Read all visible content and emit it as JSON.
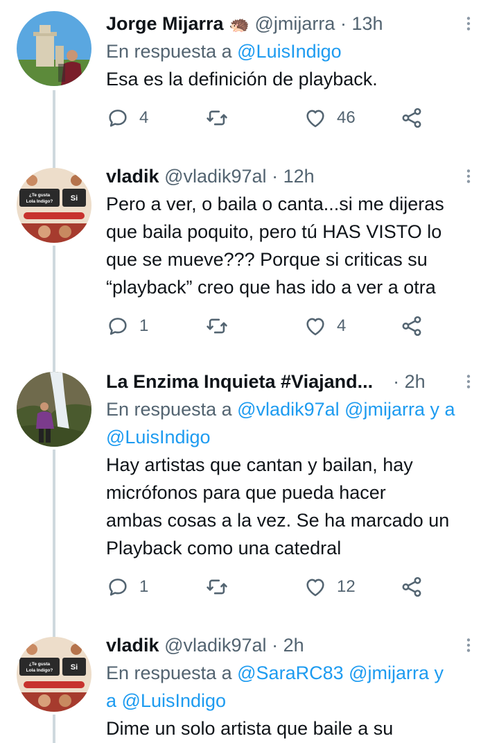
{
  "tweets": [
    {
      "name": "Jorge Mijarra",
      "emoji": "🦔",
      "handle": "@jmijarra",
      "separator": "·",
      "time": "13h",
      "reply_prefix": "En respuesta a",
      "reply_mentions": "@LuisIndigo",
      "text": "Esa es la definición de playback.",
      "stats": {
        "replies": "4",
        "retweets": "",
        "likes": "46"
      }
    },
    {
      "name": "vladik",
      "handle": "@vladik97al",
      "separator": "·",
      "time": "12h",
      "lines": [
        "Pero a ver, o baila o canta...si me dijeras",
        "que baila poquito, pero tú HAS VISTO lo",
        "que se mueve??? Porque si criticas su",
        "“playback” creo que has ido a ver a otra"
      ],
      "stats": {
        "replies": "1",
        "retweets": "",
        "likes": "4"
      }
    },
    {
      "name": "La Enzima Inquieta #Viajand...",
      "separator": "·",
      "time": "2h",
      "reply_prefix": "En respuesta a",
      "reply_line1": "@vladik97al @jmijarra y a",
      "reply_line2": "@LuisIndigo",
      "lines": [
        "Hay artistas que cantan y bailan, hay",
        "micrófonos para que pueda hacer",
        "ambas cosas a la vez. Se ha marcado un",
        "Playback como una catedral"
      ],
      "stats": {
        "replies": "1",
        "retweets": "",
        "likes": "12"
      }
    },
    {
      "name": "vladik",
      "handle": "@vladik97al",
      "separator": "·",
      "time": "2h",
      "reply_prefix": "En respuesta a",
      "reply_line1": "@SaraRC83 @jmijarra y",
      "reply_line2": "a @LuisIndigo",
      "text": "Dime un solo artista que baile a su"
    }
  ],
  "avatar_text": {
    "question": "¿Te gusta Lola Indigo?",
    "answer": "Si"
  },
  "icons": {
    "reply": "reply-icon",
    "retweet": "retweet-icon",
    "like": "like-icon",
    "share": "share-icon",
    "more": "more-icon"
  },
  "colors": {
    "text": "#0f1419",
    "secondary": "#536471",
    "link": "#1d9bf0",
    "thread_line": "#cfd9de"
  }
}
